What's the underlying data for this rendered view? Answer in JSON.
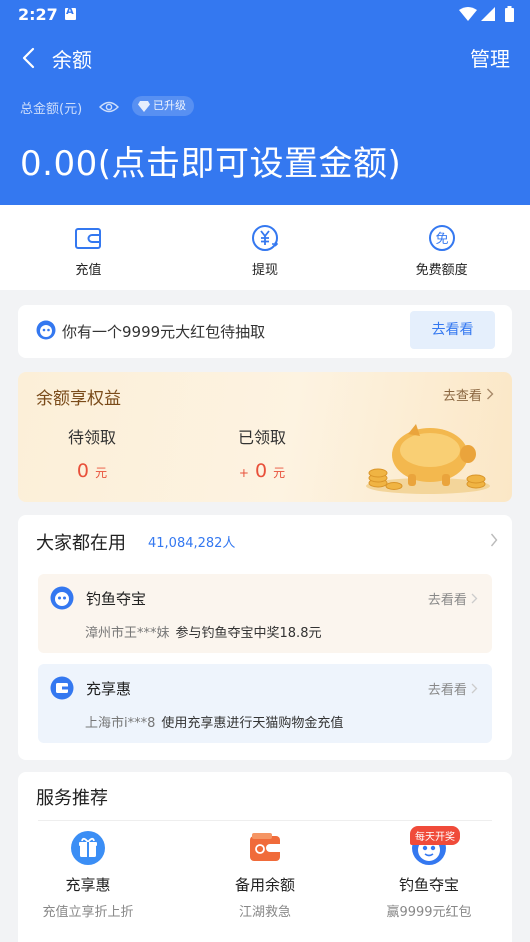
{
  "status_bar": {
    "time": "2:27"
  },
  "nav": {
    "title": "余额",
    "manage": "管理"
  },
  "balance": {
    "total_label": "总金额(元)",
    "upgrade_badge": "已升级",
    "amount": "0.00(点击即可设置金额)"
  },
  "actions": [
    {
      "label": "充值",
      "icon": "wallet-icon"
    },
    {
      "label": "提现",
      "icon": "yuan-withdraw-icon"
    },
    {
      "label": "免费额度",
      "icon": "free-icon"
    }
  ],
  "promo": {
    "text": "你有一个9999元大红包待抽取",
    "button": "去看看"
  },
  "benefit": {
    "title": "余额享权益",
    "more": "去查看",
    "pending_label": "待领取",
    "pending_value": "0",
    "claimed_label": "已领取",
    "claimed_prefix": "+",
    "claimed_value": "0",
    "unit": "元"
  },
  "popular": {
    "title": "大家都在用",
    "count": "41,084,282人",
    "items": [
      {
        "name": "钓鱼夺宝",
        "go": "去看看",
        "who": "漳州市王***妹",
        "desc": "参与钓鱼夺宝中奖18.8元",
        "bg": "#fbf5ee"
      },
      {
        "name": "充享惠",
        "go": "去看看",
        "who": "上海市i***8",
        "desc": "使用充享惠进行天猫购物金充值",
        "bg": "#eef4fc"
      }
    ]
  },
  "services": {
    "title": "服务推荐",
    "badge": "每天开奖",
    "items": [
      {
        "name": "充享惠",
        "desc": "充值立享折上折",
        "icon": "gift-icon"
      },
      {
        "name": "备用余额",
        "desc": "江湖救急",
        "icon": "backup-wallet-icon"
      },
      {
        "name": "钓鱼夺宝",
        "desc": "赢9999元红包",
        "icon": "fishing-icon"
      }
    ]
  },
  "colors": {
    "primary": "#3478f0",
    "accent_red": "#e8503a",
    "benefit_text": "#7a4b1a"
  }
}
